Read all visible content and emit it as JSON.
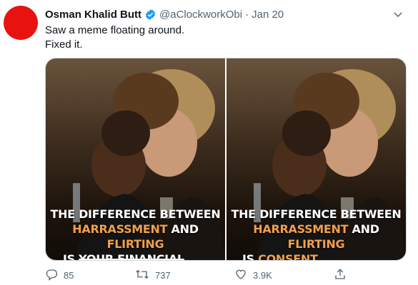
{
  "tweet": {
    "author_name": "Osman Khalid Butt",
    "handle": "@aClockworkObi",
    "separator": "·",
    "date": "Jan 20",
    "text_line1": "Saw a meme floating around.",
    "text_line2": "Fixed it."
  },
  "images": [
    {
      "caption_line1": "THE DIFFERENCE BETWEEN",
      "caption_word1": "HARRASSMENT",
      "caption_and": "AND",
      "caption_word2": "FLIRTING",
      "caption_is": "IS",
      "caption_ending": "YOUR FINANCIAL POSITION",
      "ending_struck_through": true
    },
    {
      "caption_line1": "THE DIFFERENCE BETWEEN",
      "caption_word1": "HARRASSMENT",
      "caption_and": "AND",
      "caption_word2": "FLIRTING",
      "caption_is": "IS",
      "caption_ending": "CONSENT",
      "ending_struck_through": false
    }
  ],
  "actions": {
    "replies": "85",
    "retweets": "737",
    "likes": "3.9K"
  },
  "colors": {
    "avatar": "#e8130f",
    "verified": "#1d9bf0",
    "caption_accent": "#f2a04a",
    "muted": "#536471"
  },
  "icons": {
    "verified": "verified-badge-icon",
    "more": "more-options-icon",
    "reply": "reply-icon",
    "retweet": "retweet-icon",
    "like": "heart-icon",
    "share": "share-icon"
  }
}
